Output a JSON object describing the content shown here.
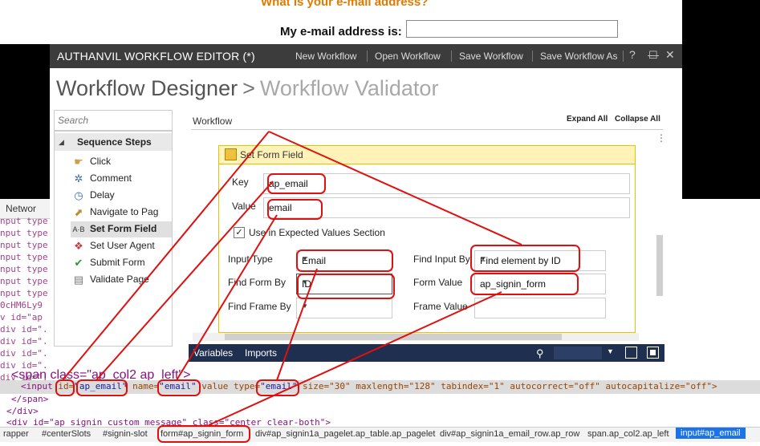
{
  "webpage": {
    "question": "What is your e-mail address?",
    "label": "My e-mail address is:"
  },
  "devtools": {
    "tab": "Networ",
    "left_code": [
      "nput type",
      "nput type",
      "nput type",
      "nput type",
      "nput type",
      "nput type",
      "nput type",
      "0cHM6Ly9",
      "v id=\"ap",
      "div id=\".",
      "div id=\".",
      "div id=\".",
      "div id=\".",
      "div id=\"."
    ],
    "line_span1": "<span class=\"ap_col2 ap_left\">",
    "sel_input": "<input",
    "sel_id_attr": "id=",
    "sel_id_val": "\"ap_email\"",
    "sel_name_attr": " name=",
    "sel_name_val": "\"email\"",
    "sel_value_attr": " value type=",
    "sel_type_val": "\"email\"",
    "sel_rest": " size=\"30\" maxlength=\"128\" tabindex=\"1\" autocorrect=\"off\" autocapitalize=\"off\">",
    "line_span_close": "</span>",
    "line_div_close": "</div>",
    "line_div_msg": "<div id=\"ap_signin_custom_message\" class=\"center clear-both\">",
    "breadcrumbs": [
      "rapper",
      "#centerSlots",
      "#signin-slot",
      "form#ap_signin_form",
      "div#ap_signin1a_pagelet.ap_table.ap_pagelet",
      "div#ap_signin1a_email_row.ap_row",
      "span.ap_col2.ap_left",
      "input#ap_email"
    ]
  },
  "app": {
    "title": "AUTHANVIL WORKFLOW EDITOR (*)",
    "toolbar": [
      "New Workflow",
      "Open Workflow",
      "Save Workflow",
      "Save Workflow As"
    ],
    "window_controls": [
      "?",
      "—",
      "☐",
      "✕"
    ],
    "breadcrumb_1": "Workflow Designer",
    "breadcrumb_sep": ">",
    "breadcrumb_2": "Workflow Validator",
    "search_placeholder": "Search",
    "steps_header": "Sequence Steps",
    "steps": [
      {
        "label": "Click",
        "icon": "hand-icon"
      },
      {
        "label": "Comment",
        "icon": "gear-icon"
      },
      {
        "label": "Delay",
        "icon": "clock-icon"
      },
      {
        "label": "Navigate to Pag",
        "icon": "navigate-icon"
      },
      {
        "label": "Set Form Field",
        "icon": "text-field-icon"
      },
      {
        "label": "Set User Agent",
        "icon": "user-agent-icon"
      },
      {
        "label": "Submit Form",
        "icon": "checkmark-icon"
      },
      {
        "label": "Validate Page",
        "icon": "validate-icon"
      }
    ],
    "workflow_label": "Workflow",
    "expand_all": "Expand All",
    "collapse_all": "Collapse All",
    "card_title": "Set Form Field",
    "key_label": "Key",
    "key_value": "ap_email",
    "value_label": "Value",
    "value_value": "email",
    "checkbox_label": "Use in Expected Values Section",
    "input_type_label": "Input Type",
    "input_type_value": "Email",
    "find_input_label": "Find Input By",
    "find_input_value": "Find element by ID",
    "find_form_label": "Find Form By",
    "find_form_value": "ID",
    "form_value_label": "Form Value",
    "form_value_value": "ap_signin_form",
    "find_frame_label": "Find Frame By",
    "frame_value_label": "Frame Value",
    "bottom_tabs": [
      "Variables",
      "Imports"
    ]
  },
  "colors": {
    "annotation": "#e01010",
    "titlebar": "#3c3c3c",
    "bottombar": "#1f2f4f",
    "card_border": "#e6c200"
  }
}
